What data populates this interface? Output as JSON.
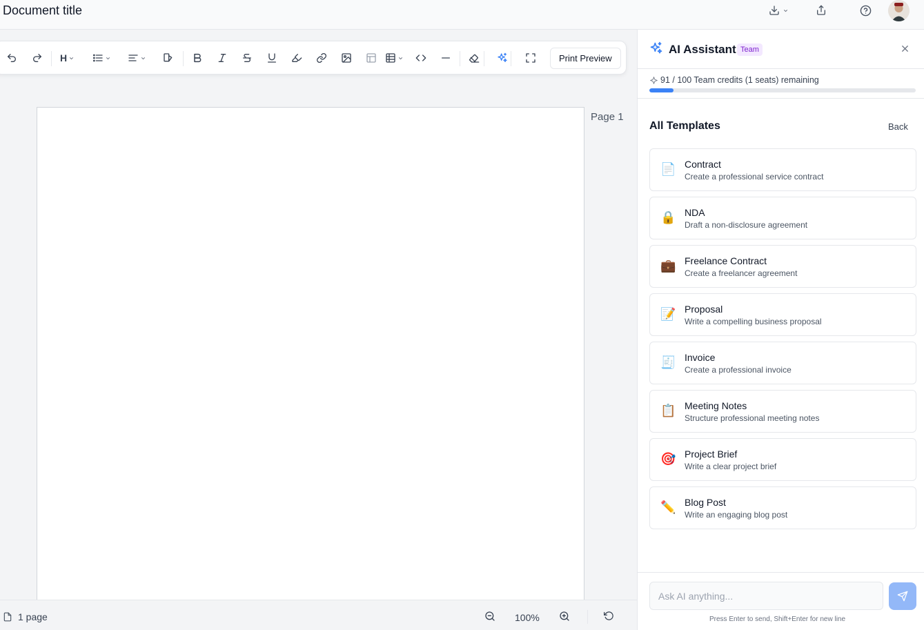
{
  "header": {
    "title": "Document title",
    "download_icon": "download-icon",
    "share_icon": "share-icon",
    "help_icon": "help-icon"
  },
  "toolbar": {
    "heading_label": "H",
    "print_preview_label": "Print Preview"
  },
  "document": {
    "page_label": "Page 1"
  },
  "statusbar": {
    "page_count": "1 page",
    "zoom": "100%"
  },
  "sidebar": {
    "title": "AI Assistant",
    "badge": "Team",
    "credits_text": "91 / 100 Team credits (1 seats) remaining",
    "credits_used_fraction": 0.09,
    "templates_title": "All Templates",
    "back_label": "Back",
    "templates": [
      {
        "icon": "📄",
        "name": "Contract",
        "description": "Create a professional service contract"
      },
      {
        "icon": "🔒",
        "name": "NDA",
        "description": "Draft a non-disclosure agreement"
      },
      {
        "icon": "💼",
        "name": "Freelance Contract",
        "description": "Create a freelancer agreement"
      },
      {
        "icon": "📝",
        "name": "Proposal",
        "description": "Write a compelling business proposal"
      },
      {
        "icon": "🧾",
        "name": "Invoice",
        "description": "Create a professional invoice"
      },
      {
        "icon": "📋",
        "name": "Meeting Notes",
        "description": "Structure professional meeting notes"
      },
      {
        "icon": "🎯",
        "name": "Project Brief",
        "description": "Write a clear project brief"
      },
      {
        "icon": "✏️",
        "name": "Blog Post",
        "description": "Write an engaging blog post"
      }
    ],
    "chat_placeholder": "Ask AI anything...",
    "chat_hint": "Press Enter to send, Shift+Enter for new line"
  },
  "colors": {
    "accent": "#3b82f6",
    "send_button": "#93b8f8",
    "badge_bg": "#f3e8ff",
    "badge_text": "#7e22ce"
  }
}
